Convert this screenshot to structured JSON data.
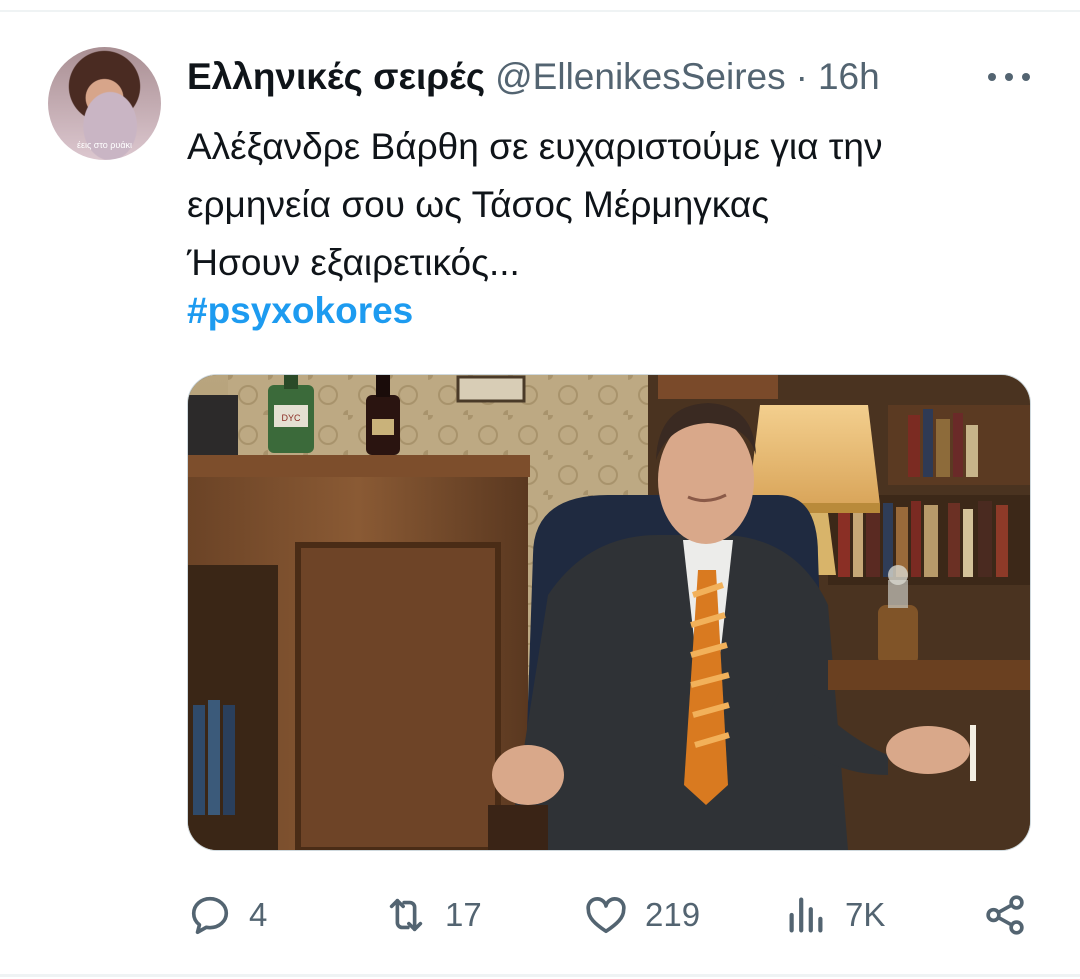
{
  "tweet": {
    "author": {
      "display_name": "Ελληνικές σειρές",
      "handle": "@EllenikesSeires",
      "avatar_caption": "έεις στο ρυάκι"
    },
    "separator": "·",
    "timestamp": "16h",
    "text_lines": [
      "Αλέξανδρε Βάρθη σε ευχαριστούμε για την",
      "ερμηνεία σου ως Τάσος Μέρμηγκας",
      "Ήσουν εξαιρετικός..."
    ],
    "hashtag": "#psyxokores",
    "media": {
      "bottle_label": "DYC"
    },
    "actions": {
      "replies": "4",
      "retweets": "17",
      "likes": "219",
      "views": "7K"
    }
  },
  "icons": {
    "more": "more-horizontal-icon",
    "reply": "comment-bubble-icon",
    "retweet": "retweet-arrows-icon",
    "like": "heart-icon",
    "views": "bar-chart-icon",
    "share": "share-nodes-icon"
  },
  "colors": {
    "text_primary": "#0f1419",
    "text_secondary": "#536471",
    "accent": "#1d9bf0",
    "border": "#cfd9de"
  }
}
